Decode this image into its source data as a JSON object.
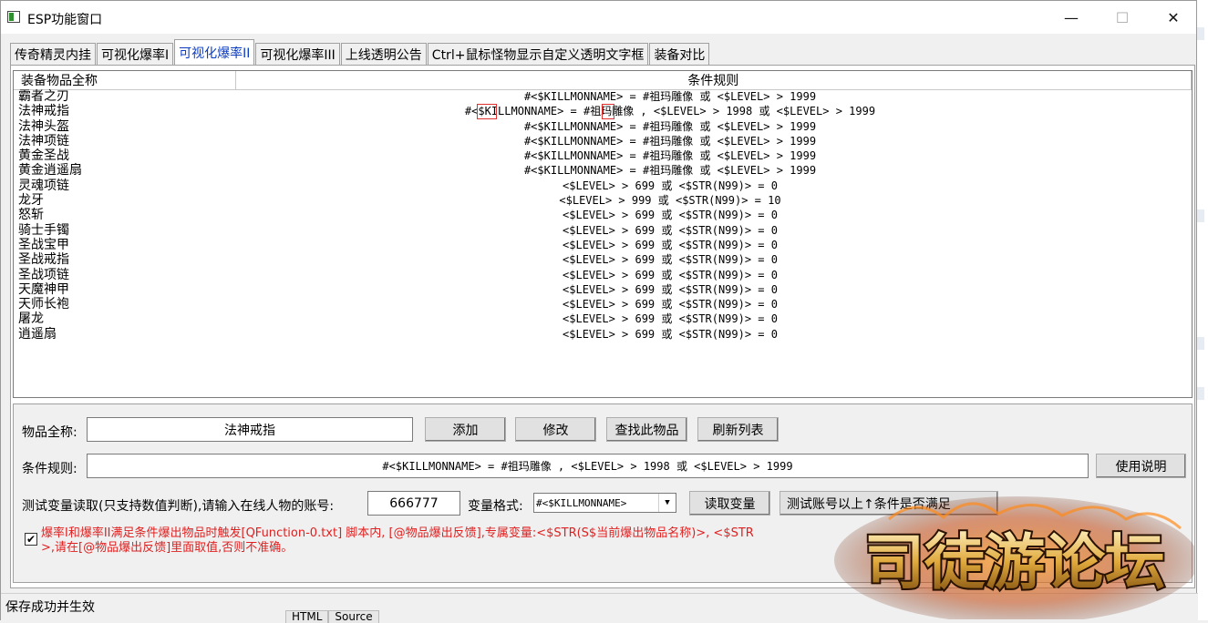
{
  "window": {
    "title": "ESP功能窗口",
    "minimize": "—",
    "maximize": "☐",
    "close": "✕"
  },
  "tabs": [
    {
      "label": "传奇精灵内挂"
    },
    {
      "label": "可视化爆率I"
    },
    {
      "label": "可视化爆率II",
      "active": true
    },
    {
      "label": "可视化爆率III"
    },
    {
      "label": "上线透明公告"
    },
    {
      "label": "Ctrl+鼠标怪物显示自定义透明文字框"
    },
    {
      "label": "装备对比"
    }
  ],
  "list": {
    "col_name": "装备物品全称",
    "col_rule": "条件规则",
    "rows": [
      {
        "name": "霸者之刃",
        "rule": "#<$KILLMONNAME> = #祖玛雕像 或 <$LEVEL> > 1999"
      },
      {
        "name": "法神戒指",
        "rule": "#<$KILLMONNAME> = #祖玛雕像 , <$LEVEL> > 1998 或 <$LEVEL> > 1999"
      },
      {
        "name": "法神头盔",
        "rule": "#<$KILLMONNAME> = #祖玛雕像 或 <$LEVEL> > 1999"
      },
      {
        "name": "法神项链",
        "rule": "#<$KILLMONNAME> = #祖玛雕像 或 <$LEVEL> > 1999"
      },
      {
        "name": "黄金圣战",
        "rule": "#<$KILLMONNAME> = #祖玛雕像 或 <$LEVEL> > 1999"
      },
      {
        "name": "黄金逍遥扇",
        "rule": "#<$KILLMONNAME> = #祖玛雕像 或 <$LEVEL> > 1999"
      },
      {
        "name": "灵魂项链",
        "rule": "<$LEVEL> > 699 或 <$STR(N99)> = 0"
      },
      {
        "name": "龙牙",
        "rule": "<$LEVEL> > 999 或 <$STR(N99)> = 10"
      },
      {
        "name": "怒斩",
        "rule": "<$LEVEL> > 699 或 <$STR(N99)> = 0"
      },
      {
        "name": "骑士手镯",
        "rule": "<$LEVEL> > 699 或 <$STR(N99)> = 0"
      },
      {
        "name": "圣战宝甲",
        "rule": "<$LEVEL> > 699 或 <$STR(N99)> = 0"
      },
      {
        "name": "圣战戒指",
        "rule": "<$LEVEL> > 699 或 <$STR(N99)> = 0"
      },
      {
        "name": "圣战项链",
        "rule": "<$LEVEL> > 699 或 <$STR(N99)> = 0"
      },
      {
        "name": "天魔神甲",
        "rule": "<$LEVEL> > 699 或 <$STR(N99)> = 0"
      },
      {
        "name": "天师长袍",
        "rule": "<$LEVEL> > 699 或 <$STR(N99)> = 0"
      },
      {
        "name": "屠龙",
        "rule": "<$LEVEL> > 699 或 <$STR(N99)> = 0"
      },
      {
        "name": "逍遥扇",
        "rule": "<$LEVEL> > 699 或 <$STR(N99)> = 0"
      }
    ]
  },
  "form": {
    "item_label": "物品全称:",
    "item_value": "法神戒指",
    "add": "添加",
    "modify": "修改",
    "find": "查找此物品",
    "refresh": "刷新列表",
    "rule_label": "条件规则:",
    "rule_value": "#<$KILLMONNAME> = #祖玛雕像 , <$LEVEL> > 1998 或 <$LEVEL> > 1999",
    "help": "使用说明",
    "test_label": "测试变量读取(只支持数值判断),请输入在线人物的账号:",
    "account_value": "666777",
    "var_format_label": "变量格式:",
    "var_format_value": "#<$KILLMONNAME>",
    "read_var": "读取变量",
    "test_account": "测试账号以上↑条件是否满足",
    "checkbox_checked": true,
    "note_line1": "爆率I和爆率II满足条件爆出物品时触发[QFunction-0.txt] 脚本内, [@物品爆出反馈],专属变量:<$STR(S$当前爆出物品名称)>, <$STR",
    "note_line2": ">,请在[@物品爆出反馈]里面取值,否则不准确。"
  },
  "status": {
    "text": "保存成功并生效",
    "bg_tab1": "HTML",
    "bg_tab2": "Source"
  },
  "watermark": {
    "text": "司徒游论坛"
  }
}
